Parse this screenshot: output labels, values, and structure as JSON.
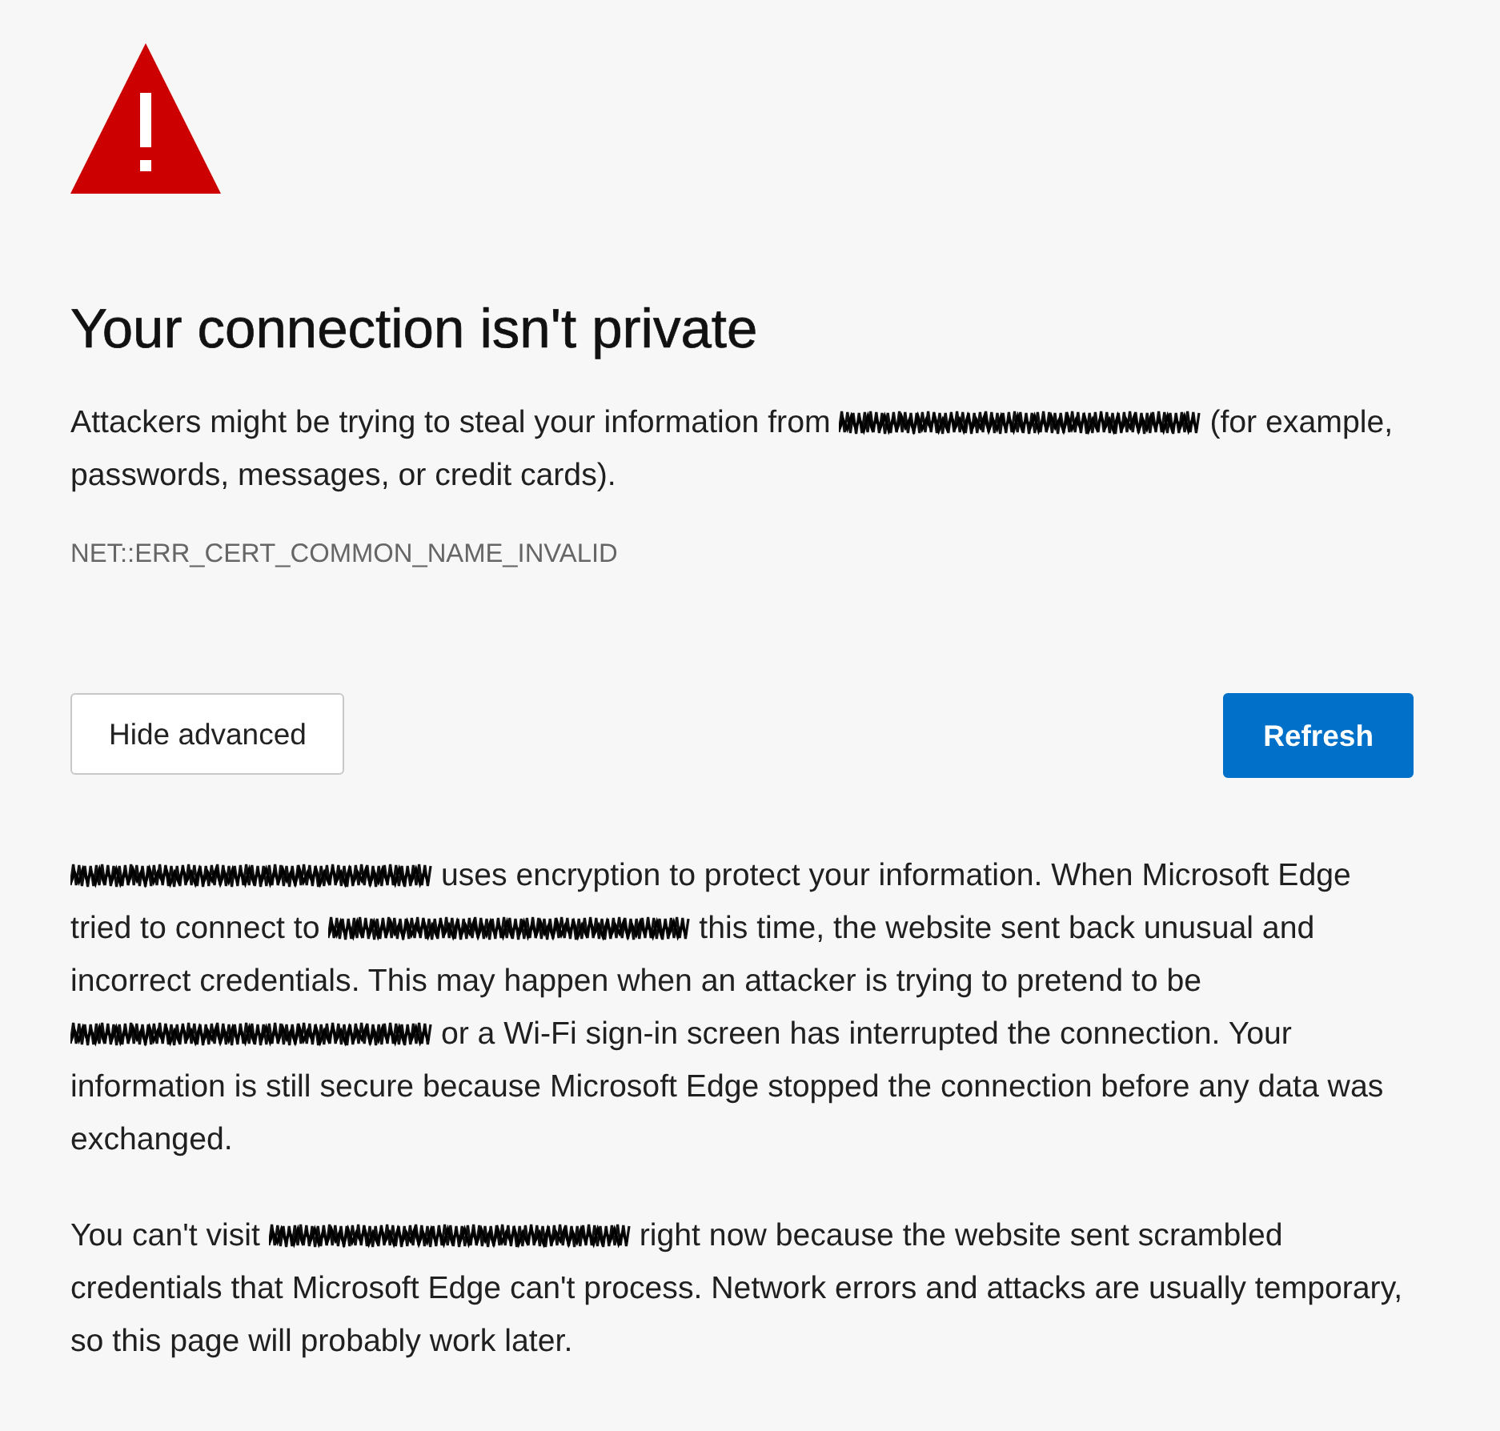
{
  "title": "Your connection isn't private",
  "description": {
    "segments": [
      {
        "kind": "text",
        "text": "Attackers might be trying to steal your information from "
      },
      {
        "kind": "redaction"
      },
      {
        "kind": "text",
        "text": " (for example, passwords, messages, or credit cards)."
      }
    ]
  },
  "error_code": "NET::ERR_CERT_COMMON_NAME_INVALID",
  "buttons": [
    {
      "kind": "secondary",
      "label": "Hide advanced"
    },
    {
      "kind": "primary",
      "label": "Refresh"
    }
  ],
  "details": [
    {
      "segments": [
        {
          "kind": "redaction"
        },
        {
          "kind": "text",
          "text": " uses encryption to protect your information. When Microsoft Edge tried to connect to "
        },
        {
          "kind": "redaction"
        },
        {
          "kind": "text",
          "text": " this time, the website sent back unusual and incorrect credentials. This may happen when an attacker is trying to pretend to be "
        },
        {
          "kind": "redaction"
        },
        {
          "kind": "text",
          "text": " or a Wi-Fi sign-in screen has interrupted the connection. Your information is still secure because Microsoft Edge stopped the connection before any data was exchanged."
        }
      ]
    },
    {
      "segments": [
        {
          "kind": "text",
          "text": "You can't visit "
        },
        {
          "kind": "redaction"
        },
        {
          "kind": "text",
          "text": " right now because the website sent scrambled credentials that Microsoft Edge can't process. Network errors and attacks are usually temporary, so this page will probably work later."
        }
      ]
    }
  ]
}
